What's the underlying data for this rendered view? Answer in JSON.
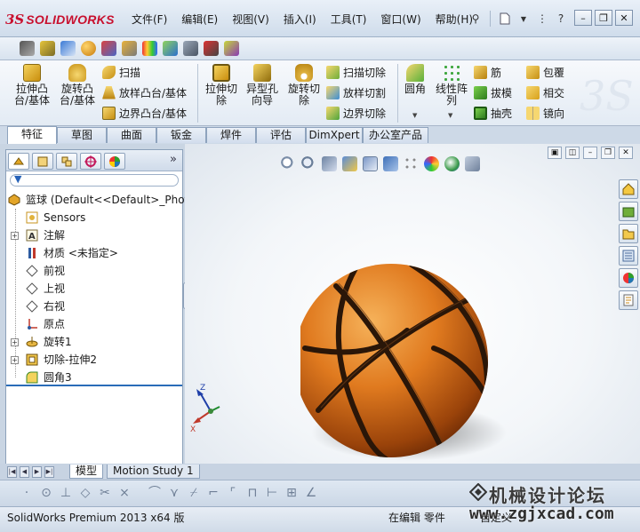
{
  "app": {
    "brand": "SOLIDWORKS",
    "brand_prefix": "3S"
  },
  "menu": [
    "文件(F)",
    "编辑(E)",
    "视图(V)",
    "插入(I)",
    "工具(T)",
    "窗口(W)",
    "帮助(H)"
  ],
  "command_manager": {
    "extrude_boss": "拉伸凸\n台/基体",
    "revolve_boss": "旋转凸\n台/基体",
    "sweep": "扫描",
    "loft_boss": "放样凸台/基体",
    "boundary_boss": "边界凸台/基体",
    "extrude_cut": "拉伸切\n除",
    "hole_wizard": "异型孔\n向导",
    "revolve_cut": "旋转切\n除",
    "sweep_cut": "扫描切除",
    "loft_cut": "放样切割",
    "boundary_cut": "边界切除",
    "fillet": "圆角",
    "linear_pattern": "线性阵\n列",
    "rib": "筋",
    "draft": "拔模",
    "shell": "抽壳",
    "wrap": "包覆",
    "intersect": "相交",
    "mirror": "镜向"
  },
  "tabs": [
    "特征",
    "草图",
    "曲面",
    "钣金",
    "焊件",
    "评估",
    "DimXpert",
    "办公室产品"
  ],
  "active_tab": "特征",
  "tree": {
    "root": "篮球  (Default<<Default>_Phot",
    "items": [
      "Sensors",
      "注解",
      "材质 <未指定>",
      "前视",
      "上视",
      "右视",
      "原点",
      "旋转1",
      "切除-拉伸2",
      "圆角3"
    ]
  },
  "bottom_tabs": [
    "模型",
    "Motion Study 1"
  ],
  "active_bottom_tab": "模型",
  "status": {
    "version": "SolidWorks Premium 2013 x64 版",
    "mode": "在编辑 零件",
    "unit": "自定义"
  },
  "watermark": {
    "line1": "机械设计论坛",
    "line2": "www.zgjxcad.com"
  },
  "colors": {
    "ball_orange": "#e07a1f",
    "seam": "#2a1608",
    "brand_red": "#c8102e"
  }
}
